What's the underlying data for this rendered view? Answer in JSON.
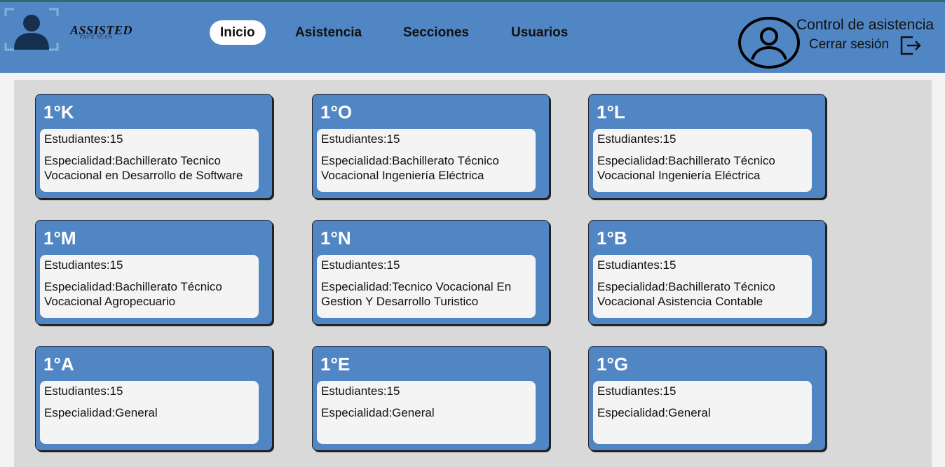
{
  "brand": {
    "name": "ASSISTED",
    "tagline": "FACE SCAN"
  },
  "nav": {
    "items": [
      "Inicio",
      "Asistencia",
      "Secciones",
      "Usuarios"
    ],
    "active": "Inicio"
  },
  "header": {
    "title": "Control de asistencia",
    "logout_label": "Cerrar sesión"
  },
  "cards": [
    {
      "name": "1°K",
      "students": "Estudiantes:15",
      "specialty": "Especialidad:Bachillerato Tecnico Vocacional en Desarrollo de Software"
    },
    {
      "name": "1°O",
      "students": "Estudiantes:15",
      "specialty": "Especialidad:Bachillerato Técnico Vocacional Ingeniería Eléctrica"
    },
    {
      "name": "1°L",
      "students": "Estudiantes:15",
      "specialty": "Especialidad:Bachillerato Técnico Vocacional Ingeniería Eléctrica"
    },
    {
      "name": "1°M",
      "students": "Estudiantes:15",
      "specialty": "Especialidad:Bachillerato Técnico Vocacional Agropecuario"
    },
    {
      "name": "1°N",
      "students": "Estudiantes:15",
      "specialty": "Especialidad:Tecnico Vocacional En Gestion Y Desarrollo Turistico"
    },
    {
      "name": "1°B",
      "students": "Estudiantes:15",
      "specialty": "Especialidad:Bachillerato Técnico Vocacional Asistencia Contable"
    },
    {
      "name": "1°A",
      "students": "Estudiantes:15",
      "specialty": "Especialidad:General"
    },
    {
      "name": "1°E",
      "students": "Estudiantes:15",
      "specialty": "Especialidad:General"
    },
    {
      "name": "1°G",
      "students": "Estudiantes:15",
      "specialty": "Especialidad:General"
    }
  ],
  "colors": {
    "header_bg": "#5186c4",
    "card_bg": "#5186c4",
    "panel_bg": "#d9d9d9",
    "accent_top": "#2a6e6a"
  }
}
